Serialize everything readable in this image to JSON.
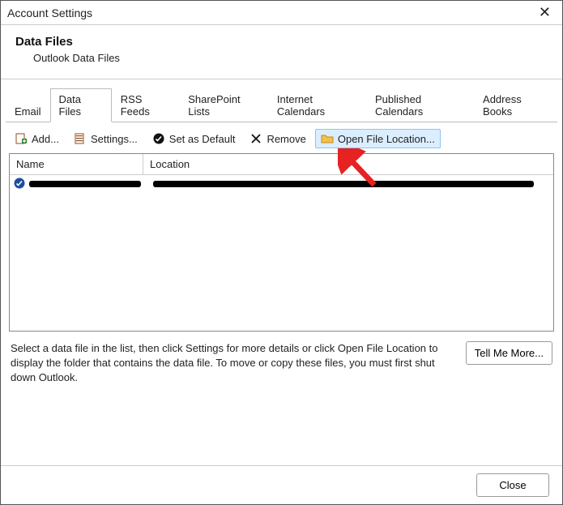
{
  "window": {
    "title": "Account Settings"
  },
  "header": {
    "title": "Data Files",
    "subtitle": "Outlook Data Files"
  },
  "tabs": [
    {
      "label": "Email"
    },
    {
      "label": "Data Files"
    },
    {
      "label": "RSS Feeds"
    },
    {
      "label": "SharePoint Lists"
    },
    {
      "label": "Internet Calendars"
    },
    {
      "label": "Published Calendars"
    },
    {
      "label": "Address Books"
    }
  ],
  "toolbar": {
    "add": "Add...",
    "settings": "Settings...",
    "set_default": "Set as Default",
    "remove": "Remove",
    "open_location": "Open File Location..."
  },
  "list": {
    "col_name": "Name",
    "col_location": "Location"
  },
  "hint": "Select a data file in the list, then click Settings for more details or click Open File Location to display the folder that contains the data file. To move or copy these files, you must first shut down Outlook.",
  "buttons": {
    "tell_me_more": "Tell Me More...",
    "close": "Close"
  }
}
